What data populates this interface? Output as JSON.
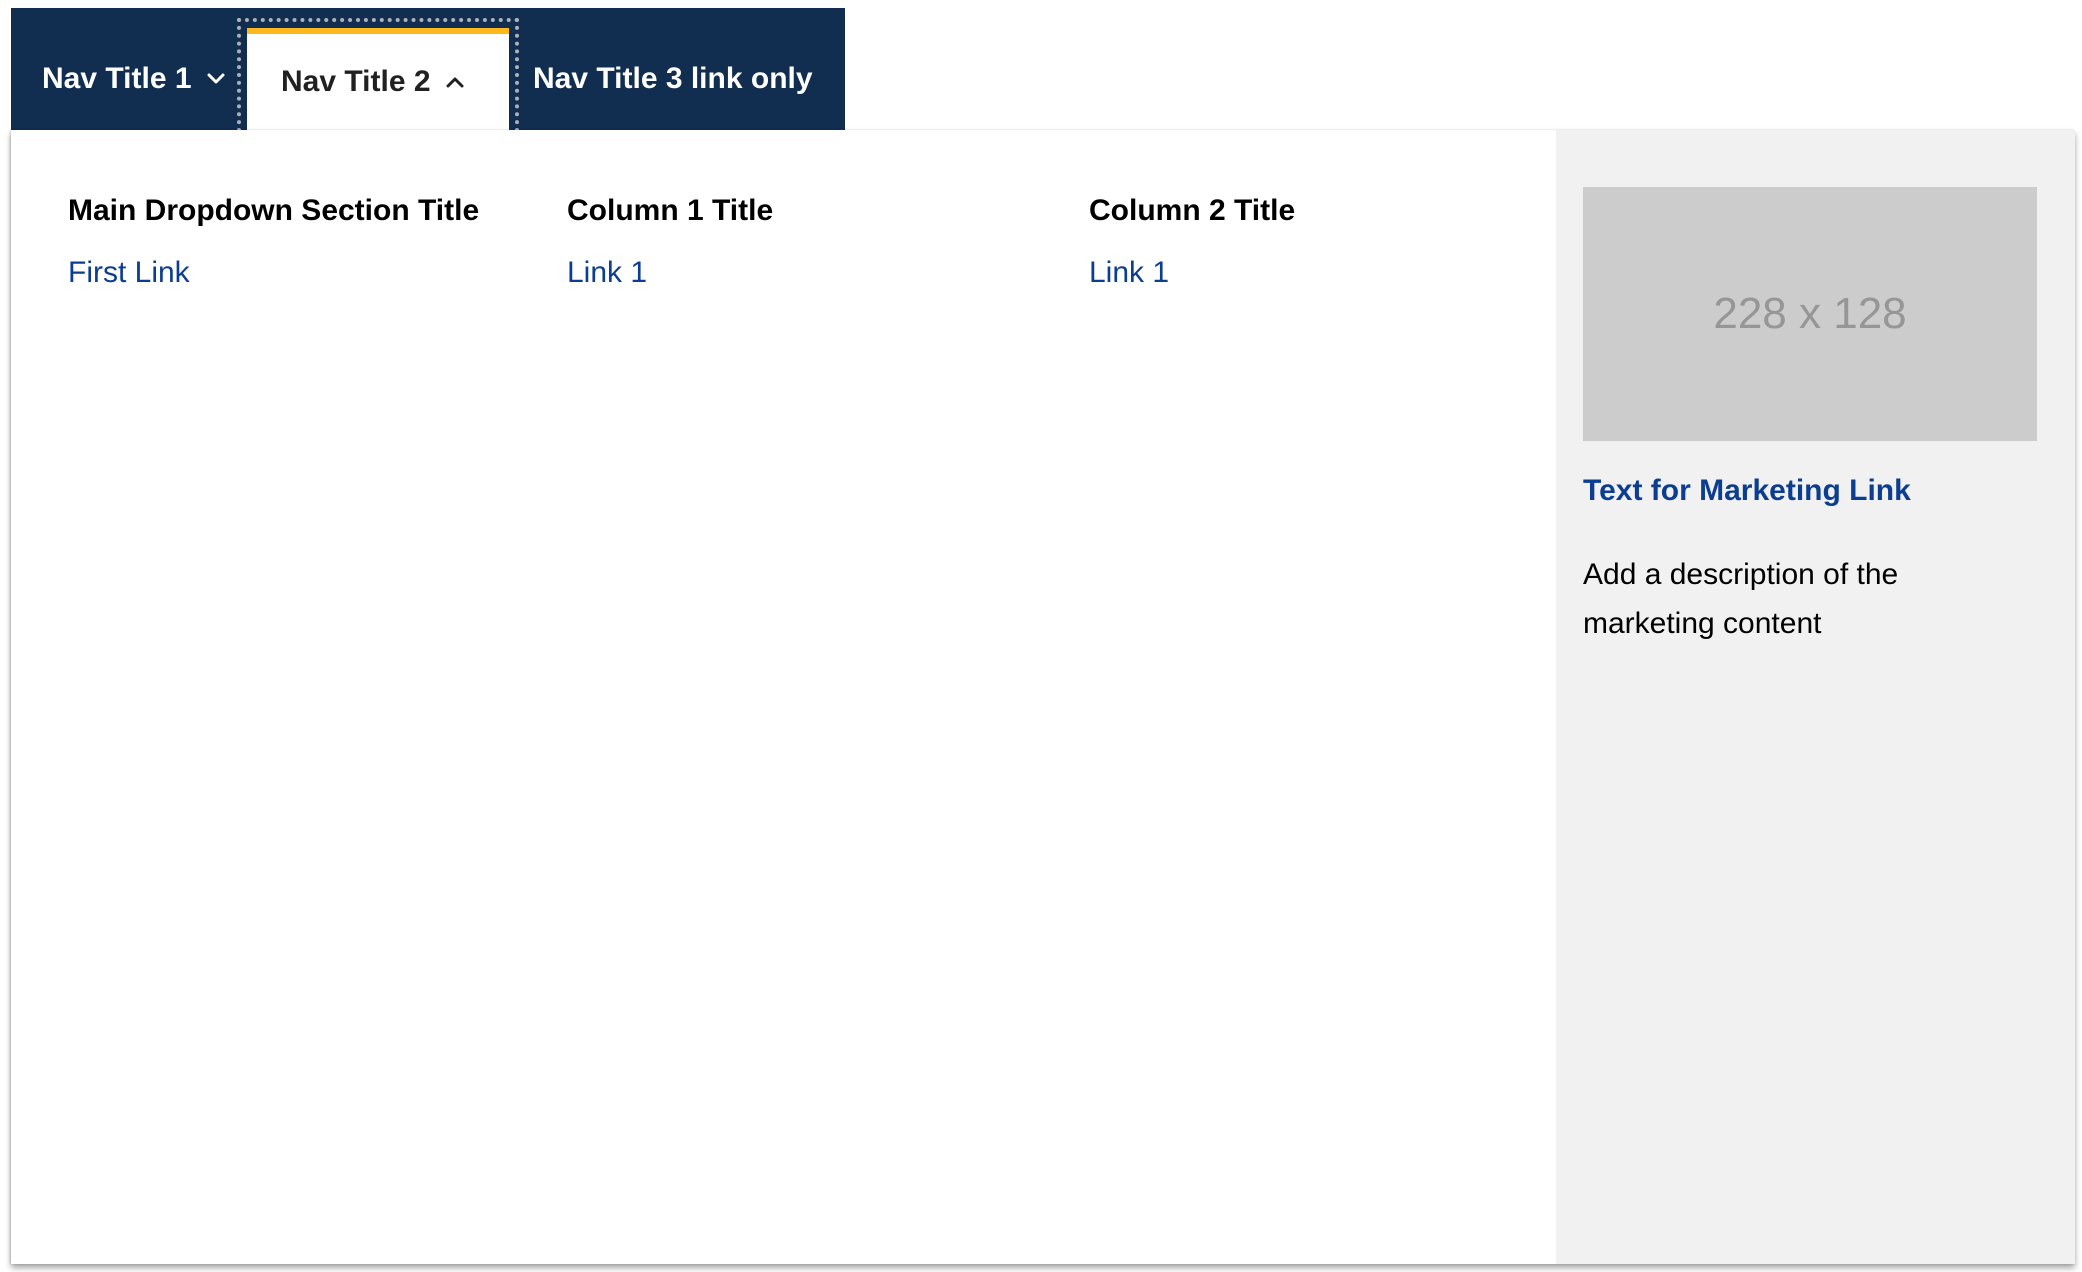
{
  "nav": {
    "items": [
      {
        "label": "Nav Title 1",
        "has_dropdown": true,
        "expanded": false
      },
      {
        "label": "Nav Title 2",
        "has_dropdown": true,
        "expanded": true
      },
      {
        "label": "Nav Title 3 link only",
        "has_dropdown": false,
        "expanded": false
      }
    ]
  },
  "dropdown": {
    "main": {
      "title": "Main Dropdown Section Title",
      "links": [
        "First Link"
      ]
    },
    "column1": {
      "title": "Column 1 Title",
      "links": [
        "Link 1"
      ]
    },
    "column2": {
      "title": "Column 2 Title",
      "links": [
        "Link 1"
      ]
    }
  },
  "marketing": {
    "image_placeholder": "228 x 128",
    "link_text": "Text for Marketing Link",
    "description": "Add a description of the marketing content"
  },
  "colors": {
    "nav_background": "#112e51",
    "active_tab_accent": "#fdb81e",
    "link": "#0b3d91",
    "sidebar_background": "#f1f1f1",
    "image_placeholder_background": "#cccccc"
  },
  "icons": {
    "collapsed": "chevron-down-icon",
    "expanded": "chevron-up-icon"
  }
}
